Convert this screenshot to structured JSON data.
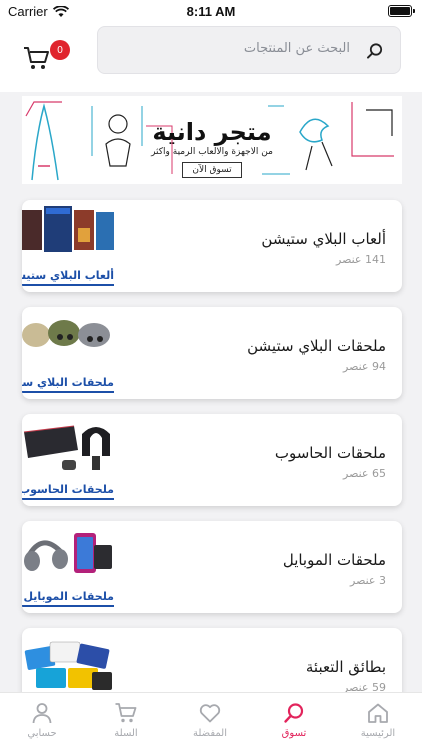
{
  "status_bar": {
    "carrier": "Carrier",
    "time": "8:11 AM"
  },
  "header": {
    "cart_count": "0",
    "search_placeholder": "البحث عن المنتجات"
  },
  "banner": {
    "title": "متجر دانية",
    "subtitle": "من الاجهزة والالعاب الرمية واكثر",
    "cta": "تسوق الآن"
  },
  "categories": [
    {
      "title": "ألعاب البلاي ستيشن",
      "count": "141 عنصر",
      "thumb_caption": "ألعاب البلاي ستيشن"
    },
    {
      "title": "ملحقات البلاي ستيشن",
      "count": "94 عنصر",
      "thumb_caption": "ملحقات البلاي ستيشن"
    },
    {
      "title": "ملحقات الحاسوب",
      "count": "65 عنصر",
      "thumb_caption": "ملحقات الحاسوب"
    },
    {
      "title": "ملحقات الموبايل",
      "count": "3 عنصر",
      "thumb_caption": "ملحقات الموبايل"
    },
    {
      "title": "بطائق التعبئة",
      "count": "59 عنصر",
      "thumb_caption": ""
    }
  ],
  "tabs": [
    {
      "label": "حسابي",
      "icon": "user-icon"
    },
    {
      "label": "السلة",
      "icon": "cart-icon"
    },
    {
      "label": "المفضلة",
      "icon": "heart-icon"
    },
    {
      "label": "تسوق",
      "icon": "search-icon"
    },
    {
      "label": "الرئيسية",
      "icon": "home-icon"
    }
  ],
  "colors": {
    "accent": "#e2245c",
    "badge": "#e0242d",
    "brand_blue": "#1c4fa8"
  }
}
